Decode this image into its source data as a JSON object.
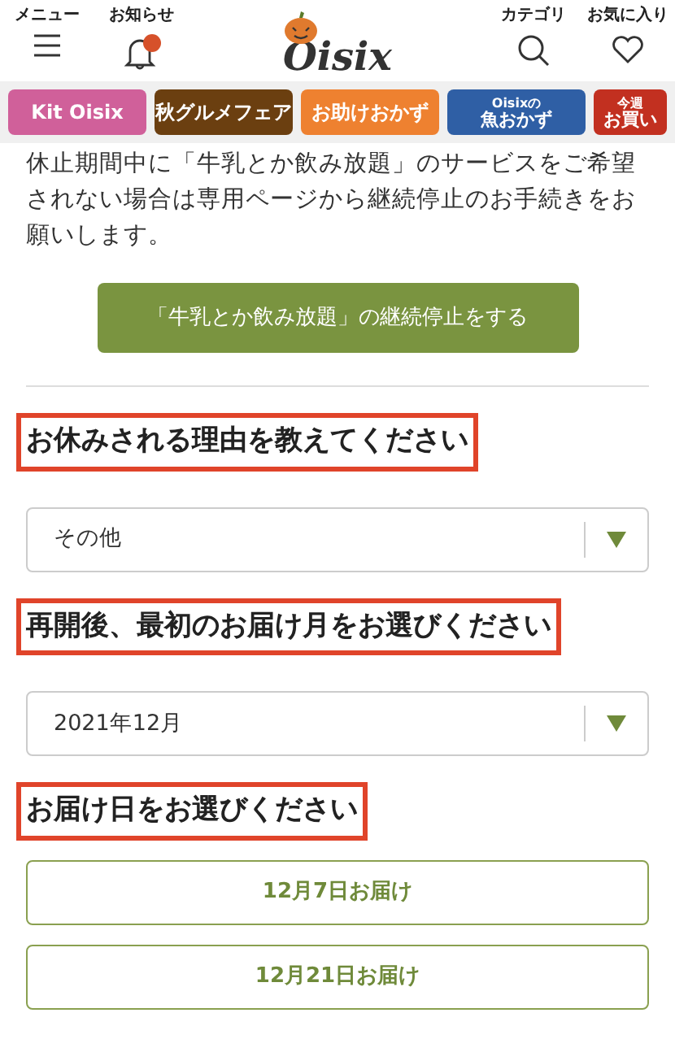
{
  "header": {
    "nav": [
      {
        "label": "メニュー",
        "kind": "menu"
      },
      {
        "label": "お知らせ",
        "kind": "bell",
        "badge": true
      },
      {
        "label": "カテゴリ",
        "kind": "search"
      },
      {
        "label": "お気に入り",
        "kind": "heart"
      }
    ],
    "logo": "Oisix"
  },
  "banners": [
    {
      "label": "Kit Oisix",
      "color": "#d0609a"
    },
    {
      "label": "秋グルメフェア",
      "color": "#6b3f10"
    },
    {
      "label": "お助けおかず",
      "color": "#ee8130"
    },
    {
      "label": "魚おかず",
      "sublabel": "Oisixの",
      "color": "#2f5fa5"
    },
    {
      "label": "お買い",
      "sublabel": "今週",
      "color": "#c23020"
    }
  ],
  "notice": "休止期間中に「牛乳とか飲み放題」のサービスをご希望されない場合は専用ページから継続停止のお手続きをお願いします。",
  "stop_button": "「牛乳とか飲み放題」の継続停止をする",
  "sections": [
    {
      "heading": "お休みされる理由を教えてください",
      "kind": "select",
      "value": "その他"
    },
    {
      "heading": "再開後、最初のお届け月をお選びください",
      "kind": "select",
      "value": "2021年12月"
    },
    {
      "heading": "お届け日をお選びください",
      "kind": "dates",
      "options": [
        "12月7日お届け",
        "12月21日お届け"
      ]
    }
  ]
}
